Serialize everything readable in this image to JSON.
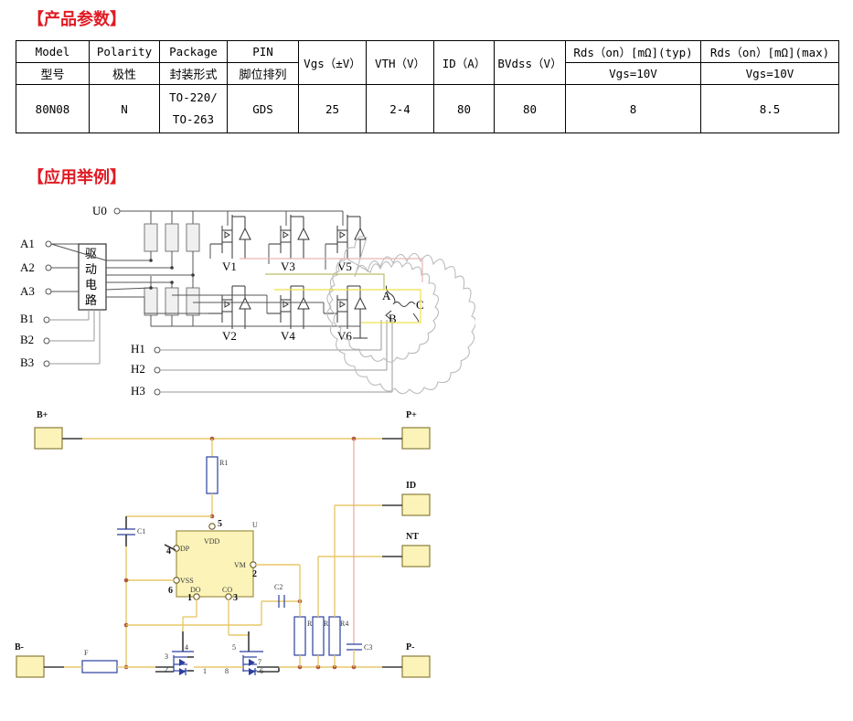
{
  "sections": {
    "params_title": "【产品参数】",
    "apps_title": "【应用举例】"
  },
  "param_table": {
    "headers_en": [
      "Model",
      "Polarity",
      "Package",
      "PIN",
      "Vgs（±V）",
      "VTH（V）",
      "ID（A）",
      "BVdss（V）",
      "Rds（on）[mΩ](typ)",
      "Rds（on）[mΩ](max)"
    ],
    "headers_cn": [
      "型号",
      "极性",
      "封装形式",
      "脚位排列",
      "",
      "",
      "",
      "",
      "Vgs=10V",
      "Vgs=10V"
    ],
    "row": {
      "model": "80N08",
      "polarity": "N",
      "package_line1": "TO-220/",
      "package_line2": "TO-263",
      "pin": "GDS",
      "vgs": "25",
      "vth": "2-4",
      "id": "80",
      "bvdss": "80",
      "rds_typ": "8",
      "rds_max": "8.5"
    }
  },
  "motor_diagram": {
    "name": "three-phase-bldc-motor-driver",
    "supply_label": "U0",
    "driver_block_label": "驱动电路",
    "driver_block_chars": [
      "驱",
      "动",
      "电",
      "路"
    ],
    "inputs_a": [
      "A1",
      "A2",
      "A3"
    ],
    "inputs_b": [
      "B1",
      "B2",
      "B3"
    ],
    "hall_inputs": [
      "H1",
      "H2",
      "H3"
    ],
    "transistors_top": [
      "V1",
      "V3",
      "V5"
    ],
    "transistors_bottom": [
      "V2",
      "V4",
      "V6"
    ],
    "motor_phases": [
      "A",
      "B",
      "C"
    ]
  },
  "bms_diagram": {
    "name": "battery-protection-board",
    "pads": [
      "B+",
      "P+",
      "ID",
      "NT",
      "B-",
      "P-"
    ],
    "ic": {
      "ref": "U",
      "pins": [
        {
          "num": "5",
          "name": "VDD"
        },
        {
          "num": "4",
          "name": "DP"
        },
        {
          "num": "6",
          "name": "VSS"
        },
        {
          "num": "2",
          "name": "VM"
        },
        {
          "num": "1",
          "name": "DO"
        },
        {
          "num": "3",
          "name": "CO"
        }
      ]
    },
    "resistors": [
      "R1",
      "R2",
      "R3",
      "R4"
    ],
    "capacitors": [
      "C1",
      "C2",
      "C3"
    ],
    "fuse": "F",
    "mosfet_left_pins": [
      "4",
      "3",
      "2",
      "1"
    ],
    "mosfet_right_pins": [
      "5",
      "7",
      "6",
      "8"
    ]
  },
  "colors": {
    "title_red": "#e01b24",
    "pad_yellow": "#fbf3b8",
    "wire_yellow": "#e8c96a",
    "wire_pink": "#e8a79a",
    "blue_component": "#2b3f9e"
  }
}
